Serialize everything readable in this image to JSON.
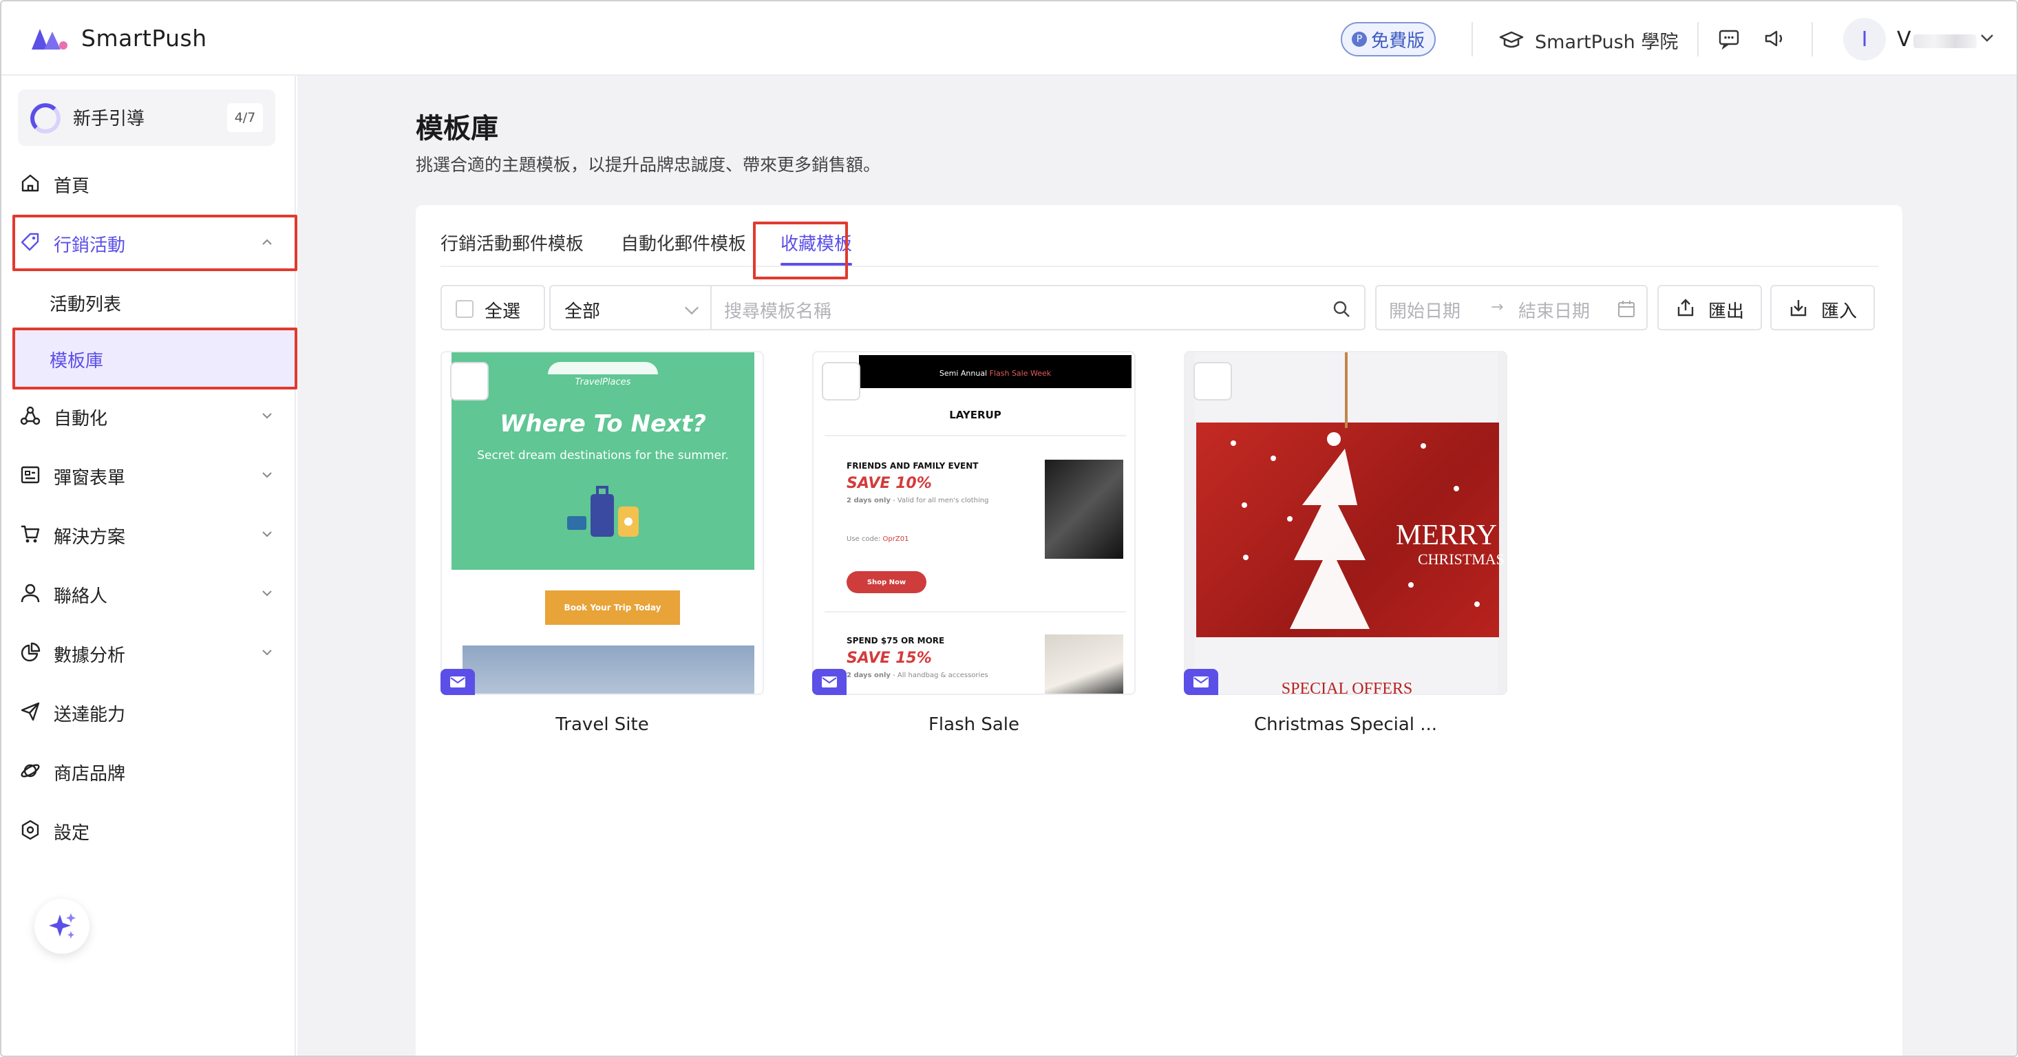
{
  "app": {
    "name": "SmartPush"
  },
  "header": {
    "free_badge": "免費版",
    "academy_label": "SmartPush 學院",
    "user_initial": "I",
    "user_name": "V"
  },
  "sidebar": {
    "guide": {
      "label": "新手引導",
      "count": "4/7"
    },
    "items": [
      {
        "label": "首頁",
        "icon": "home-icon"
      },
      {
        "label": "行銷活動",
        "icon": "tag-icon",
        "expanded": true
      },
      {
        "label": "活動列表"
      },
      {
        "label": "模板庫",
        "active": true
      },
      {
        "label": "自動化",
        "icon": "automation-icon"
      },
      {
        "label": "彈窗表單",
        "icon": "form-icon"
      },
      {
        "label": "解決方案",
        "icon": "cart-icon"
      },
      {
        "label": "聯絡人",
        "icon": "user-icon"
      },
      {
        "label": "數據分析",
        "icon": "pie-chart-icon"
      },
      {
        "label": "送達能力",
        "icon": "send-icon"
      },
      {
        "label": "商店品牌",
        "icon": "planet-icon"
      },
      {
        "label": "設定",
        "icon": "settings-icon"
      }
    ]
  },
  "main": {
    "title": "模板庫",
    "subtitle": "挑選合適的主題模板，以提升品牌忠誠度、帶來更多銷售額。",
    "tabs": [
      {
        "label": "行銷活動郵件模板"
      },
      {
        "label": "自動化郵件模板"
      },
      {
        "label": "收藏模板",
        "active": true
      }
    ],
    "toolbar": {
      "select_all": "全選",
      "filter_value": "全部",
      "search_placeholder": "搜尋模板名稱",
      "start_date_placeholder": "開始日期",
      "end_date_placeholder": "結束日期",
      "export_label": "匯出",
      "import_label": "匯入"
    },
    "templates": [
      {
        "name": "Travel Site",
        "preview": {
          "brand": "TravelPlaces",
          "headline": "Where To Next?",
          "tagline": "Secret dream destinations for the summer.",
          "cta": "Book Your Trip Today"
        }
      },
      {
        "name": "Flash Sale",
        "preview": {
          "banner_prefix": "Semi Annual ",
          "banner_highlight": "Flash Sale Week",
          "logo": "LAYERUP",
          "event1": "FRIENDS AND FAMILY EVENT",
          "save1": "SAVE 10%",
          "note1_bold": "2 days only",
          "note1": " - Valid for all men's clothing",
          "code_label": "Use code: ",
          "code": "OprZ01",
          "shop_btn": "Shop Now",
          "event2": "SPEND $75 OR MORE",
          "save2": "SAVE 15%",
          "note2_bold": "2 days only",
          "note2": " - All handbag & accessories"
        }
      },
      {
        "name": "Christmas Special ...",
        "preview": {
          "merry": "MERRY",
          "christmas": "CHRISTMAS",
          "offers": "SPECIAL OFFERS"
        }
      }
    ]
  },
  "colors": {
    "accent": "#5b4fe8",
    "highlight_red": "#e03a2f",
    "travel_green": "#5fc694",
    "sale_red": "#d43b3b",
    "xmas_red": "#b8221e"
  }
}
